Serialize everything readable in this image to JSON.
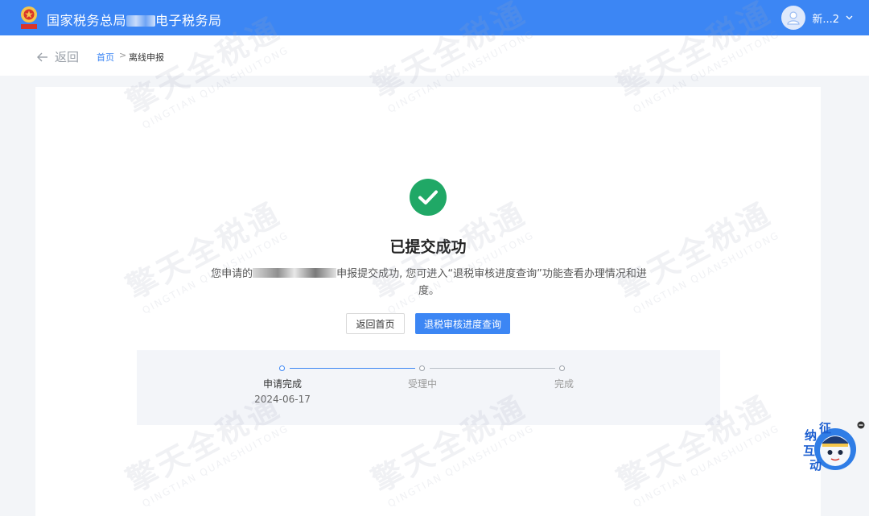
{
  "header": {
    "title_prefix": "国家税务总局",
    "title_suffix": "电子税务局",
    "username": "新...2"
  },
  "breadcrumb": {
    "back_label": "返回",
    "home_label": "首页",
    "separator": ">",
    "current_label": "离线申报"
  },
  "result": {
    "title": "已提交成功",
    "desc_prefix": "您申请的",
    "desc_suffix": "申报提交成功, 您可进入“退税审核进度查询”功能查看办理情况和进度。",
    "btn_home": "返回首页",
    "btn_query": "退税审核进度查询"
  },
  "steps": [
    {
      "label": "申请完成",
      "date": "2024-06-17",
      "state": "done"
    },
    {
      "label": "受理中",
      "date": "",
      "state": "pending"
    },
    {
      "label": "完成",
      "date": "",
      "state": "pending"
    }
  ],
  "float_widget": {
    "chars": [
      "征",
      "纳",
      "互",
      "动"
    ]
  },
  "watermark": {
    "main": "擎天全税通",
    "sub": "QINGTIAN QUANSHUITONG"
  },
  "colors": {
    "primary": "#3c86f4",
    "success": "#20a866",
    "page_bg": "#f3f5f8"
  }
}
